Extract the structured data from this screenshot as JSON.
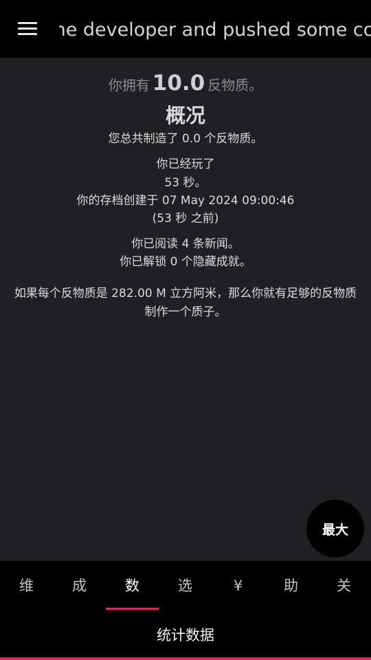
{
  "header": {
    "news_ticker": "the developer and pushed some cod"
  },
  "antimatter": {
    "prefix": "你拥有",
    "amount": "10.0",
    "suffix": "反物质。"
  },
  "stats": {
    "title": "概况",
    "total_produced": "您总共制造了 0.0 个反物质。",
    "played_label": "你已经玩了",
    "played_time": "53 秒。",
    "save_created": "你的存档创建于 07 May 2024 09:00:46",
    "save_ago": "(53 秒 之前)",
    "news_read": "你已阅读 4 条新闻。",
    "secret_achievements": "你已解锁 0 个隐藏成就。",
    "volume_comparison_1": "如果每个反物质是 282.00 M 立方阿米，那么你就有足够的反物质",
    "volume_comparison_2": "制作一个质子。"
  },
  "max_button_label": "最大",
  "tabs": [
    {
      "label": "维"
    },
    {
      "label": "成"
    },
    {
      "label": "数"
    },
    {
      "label": "选"
    },
    {
      "label": "¥"
    },
    {
      "label": "助"
    },
    {
      "label": "关"
    }
  ],
  "active_tab_index": 2,
  "subtab": {
    "label": "统计数据"
  },
  "colors": {
    "accent": "#e0245e",
    "background": "#202024",
    "bar": "#000000"
  }
}
